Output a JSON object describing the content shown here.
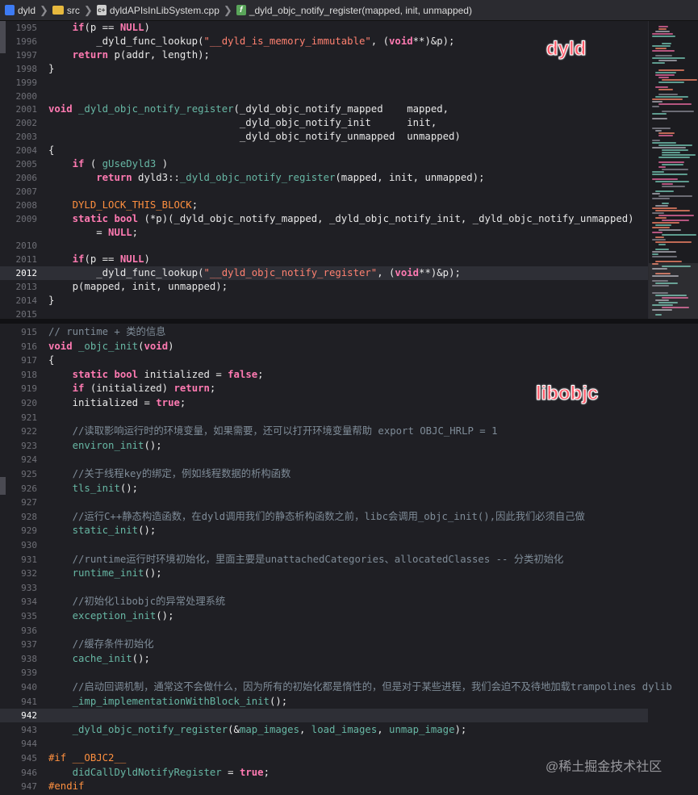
{
  "breadcrumb": {
    "project": "dyld",
    "folder": "src",
    "file": "dyldAPIsInLibSystem.cpp",
    "function": "_dyld_objc_notify_register(mapped, init, unmapped)"
  },
  "labels": {
    "top_pane": "dyld",
    "bottom_pane": "libobjc",
    "watermark": "@稀土掘金技术社区"
  },
  "top_code": [
    {
      "n": "1995",
      "t": [
        [
          "    ",
          ""
        ],
        [
          "if",
          "kw"
        ],
        [
          "(p == ",
          ""
        ],
        [
          "NULL",
          "kw"
        ],
        [
          ")",
          ""
        ]
      ]
    },
    {
      "n": "1996",
      "t": [
        [
          "        _dyld_func_lookup(",
          ""
        ],
        [
          "\"__dyld_is_memory_immutable\"",
          "str"
        ],
        [
          ", (",
          ""
        ],
        [
          "void",
          "kw"
        ],
        [
          "**)&p);",
          ""
        ]
      ]
    },
    {
      "n": "1997",
      "t": [
        [
          "    ",
          ""
        ],
        [
          "return",
          "kw"
        ],
        [
          " p(addr, length);",
          ""
        ]
      ]
    },
    {
      "n": "1998",
      "t": [
        [
          "}",
          ""
        ]
      ]
    },
    {
      "n": "1999",
      "t": []
    },
    {
      "n": "2000",
      "t": []
    },
    {
      "n": "2001",
      "t": [
        [
          "void",
          "kw"
        ],
        [
          " ",
          ""
        ],
        [
          "_dyld_objc_notify_register",
          "fn"
        ],
        [
          "(_dyld_objc_notify_mapped    mapped,",
          ""
        ]
      ]
    },
    {
      "n": "2002",
      "t": [
        [
          "                                _dyld_objc_notify_init      init,",
          ""
        ]
      ]
    },
    {
      "n": "2003",
      "t": [
        [
          "                                _dyld_objc_notify_unmapped  unmapped)",
          ""
        ]
      ]
    },
    {
      "n": "2004",
      "t": [
        [
          "{",
          ""
        ]
      ]
    },
    {
      "n": "2005",
      "t": [
        [
          "    ",
          ""
        ],
        [
          "if",
          "kw"
        ],
        [
          " ( ",
          ""
        ],
        [
          "gUseDyld3",
          "fn"
        ],
        [
          " )",
          ""
        ]
      ]
    },
    {
      "n": "2006",
      "t": [
        [
          "        ",
          ""
        ],
        [
          "return",
          "kw"
        ],
        [
          " dyld3::",
          ""
        ],
        [
          "_dyld_objc_notify_register",
          "fn"
        ],
        [
          "(mapped, init, unmapped);",
          ""
        ]
      ]
    },
    {
      "n": "2007",
      "t": []
    },
    {
      "n": "2008",
      "t": [
        [
          "    ",
          ""
        ],
        [
          "DYLD_LOCK_THIS_BLOCK",
          "mac"
        ],
        [
          ";",
          ""
        ]
      ]
    },
    {
      "n": "2009",
      "t": [
        [
          "    ",
          ""
        ],
        [
          "static",
          "kw"
        ],
        [
          " ",
          ""
        ],
        [
          "bool",
          "kw"
        ],
        [
          " (*p)(_dyld_objc_notify_mapped, _dyld_objc_notify_init, _dyld_objc_notify_unmapped)",
          ""
        ]
      ]
    },
    {
      "n": "",
      "t": [
        [
          "        = ",
          ""
        ],
        [
          "NULL",
          "kw"
        ],
        [
          ";",
          ""
        ]
      ]
    },
    {
      "n": "2010",
      "t": []
    },
    {
      "n": "2011",
      "t": [
        [
          "    ",
          ""
        ],
        [
          "if",
          "kw"
        ],
        [
          "(p == ",
          ""
        ],
        [
          "NULL",
          "kw"
        ],
        [
          ")",
          ""
        ]
      ]
    },
    {
      "n": "2012",
      "t": [
        [
          "        _dyld_func_lookup(",
          ""
        ],
        [
          "\"__dyld_objc_notify_register\"",
          "str"
        ],
        [
          ", (",
          ""
        ],
        [
          "void",
          "kw"
        ],
        [
          "**)&p);",
          ""
        ]
      ],
      "cur": true
    },
    {
      "n": "2013",
      "t": [
        [
          "    p(mapped, init, unmapped);",
          ""
        ]
      ]
    },
    {
      "n": "2014",
      "t": [
        [
          "}",
          ""
        ]
      ]
    },
    {
      "n": "2015",
      "t": []
    }
  ],
  "bottom_code": [
    {
      "n": "915",
      "t": [
        [
          "// runtime + 类的信息",
          "cmt"
        ]
      ]
    },
    {
      "n": "916",
      "t": [
        [
          "void",
          "kw"
        ],
        [
          " ",
          ""
        ],
        [
          "_objc_init",
          "fn"
        ],
        [
          "(",
          ""
        ],
        [
          "void",
          "kw"
        ],
        [
          ")",
          ""
        ]
      ]
    },
    {
      "n": "917",
      "t": [
        [
          "{",
          ""
        ]
      ]
    },
    {
      "n": "918",
      "t": [
        [
          "    ",
          ""
        ],
        [
          "static",
          "kw"
        ],
        [
          " ",
          ""
        ],
        [
          "bool",
          "kw"
        ],
        [
          " initialized = ",
          ""
        ],
        [
          "false",
          "kw"
        ],
        [
          ";",
          ""
        ]
      ]
    },
    {
      "n": "919",
      "t": [
        [
          "    ",
          ""
        ],
        [
          "if",
          "kw"
        ],
        [
          " (initialized) ",
          ""
        ],
        [
          "return",
          "kw"
        ],
        [
          ";",
          ""
        ]
      ]
    },
    {
      "n": "920",
      "t": [
        [
          "    initialized = ",
          ""
        ],
        [
          "true",
          "kw"
        ],
        [
          ";",
          ""
        ]
      ]
    },
    {
      "n": "921",
      "t": []
    },
    {
      "n": "922",
      "t": [
        [
          "    //读取影响运行时的环境变量，如果需要，还可以打开环境变量帮助 export OBJC_HRLP = 1",
          "cmt"
        ]
      ]
    },
    {
      "n": "923",
      "t": [
        [
          "    ",
          ""
        ],
        [
          "environ_init",
          "fn"
        ],
        [
          "();",
          ""
        ]
      ]
    },
    {
      "n": "924",
      "t": []
    },
    {
      "n": "925",
      "t": [
        [
          "    //关于线程key的绑定，例如线程数据的析构函数",
          "cmt"
        ]
      ]
    },
    {
      "n": "926",
      "t": [
        [
          "    ",
          ""
        ],
        [
          "tls_init",
          "fn"
        ],
        [
          "();",
          ""
        ]
      ]
    },
    {
      "n": "927",
      "t": []
    },
    {
      "n": "928",
      "t": [
        [
          "    //运行C++静态构造函数，在dyld调用我们的静态析构函数之前，libc会调用_objc_init(),因此我们必须自己做",
          "cmt"
        ]
      ]
    },
    {
      "n": "929",
      "t": [
        [
          "    ",
          ""
        ],
        [
          "static_init",
          "fn"
        ],
        [
          "();",
          ""
        ]
      ]
    },
    {
      "n": "930",
      "t": []
    },
    {
      "n": "931",
      "t": [
        [
          "    //runtime运行时环境初始化，里面主要是unattachedCategories、allocatedClasses -- 分类初始化",
          "cmt"
        ]
      ]
    },
    {
      "n": "932",
      "t": [
        [
          "    ",
          ""
        ],
        [
          "runtime_init",
          "fn"
        ],
        [
          "();",
          ""
        ]
      ]
    },
    {
      "n": "933",
      "t": []
    },
    {
      "n": "934",
      "t": [
        [
          "    //初始化libobjc的异常处理系统",
          "cmt"
        ]
      ]
    },
    {
      "n": "935",
      "t": [
        [
          "    ",
          ""
        ],
        [
          "exception_init",
          "fn"
        ],
        [
          "();",
          ""
        ]
      ]
    },
    {
      "n": "936",
      "t": []
    },
    {
      "n": "937",
      "t": [
        [
          "    //缓存条件初始化",
          "cmt"
        ]
      ]
    },
    {
      "n": "938",
      "t": [
        [
          "    ",
          ""
        ],
        [
          "cache_init",
          "fn"
        ],
        [
          "();",
          ""
        ]
      ]
    },
    {
      "n": "939",
      "t": []
    },
    {
      "n": "940",
      "t": [
        [
          "    //启动回调机制，通常这不会做什么，因为所有的初始化都是惰性的，但是对于某些进程，我们会迫不及待地加载trampolines dylib",
          "cmt"
        ]
      ]
    },
    {
      "n": "941",
      "t": [
        [
          "    ",
          ""
        ],
        [
          "_imp_implementationWithBlock_init",
          "fn"
        ],
        [
          "();",
          ""
        ]
      ]
    },
    {
      "n": "942",
      "t": [],
      "cur": true
    },
    {
      "n": "943",
      "t": [
        [
          "    ",
          ""
        ],
        [
          "_dyld_objc_notify_register",
          "fn"
        ],
        [
          "(&",
          ""
        ],
        [
          "map_images",
          "fn"
        ],
        [
          ", ",
          ""
        ],
        [
          "load_images",
          "fn"
        ],
        [
          ", ",
          ""
        ],
        [
          "unmap_image",
          "fn"
        ],
        [
          ");",
          ""
        ]
      ]
    },
    {
      "n": "944",
      "t": []
    },
    {
      "n": "945",
      "t": [
        [
          "#if",
          "pp"
        ],
        [
          " ",
          ""
        ],
        [
          "__OBJC2__",
          "mac"
        ]
      ]
    },
    {
      "n": "946",
      "t": [
        [
          "    ",
          ""
        ],
        [
          "didCallDyldNotifyRegister",
          "fn"
        ],
        [
          " = ",
          ""
        ],
        [
          "true",
          "kw"
        ],
        [
          ";",
          ""
        ]
      ]
    },
    {
      "n": "947",
      "t": [
        [
          "#endif",
          "pp"
        ]
      ]
    },
    {
      "n": "",
      "t": [
        [
          "}",
          ""
        ]
      ]
    }
  ]
}
